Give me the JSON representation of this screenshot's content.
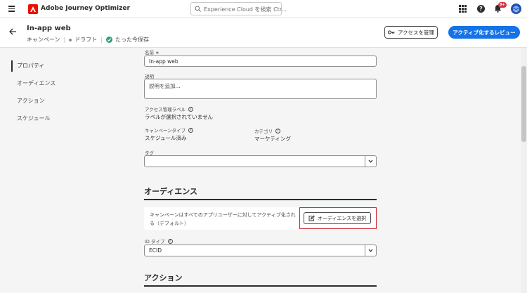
{
  "topbar": {
    "app_name": "Adobe Journey Optimizer",
    "search_placeholder": "Experience Cloud を検索 Ctr...",
    "help_label": "?",
    "notification_count": "9+"
  },
  "header": {
    "title": "In-app web",
    "type": "キャンペーン",
    "status": "ドラフト",
    "save_status": "たった今保存",
    "access_button": "アクセスを管理",
    "review_button": "アクティブ化するレビュー"
  },
  "nav": {
    "items": [
      {
        "label": "プロパティ"
      },
      {
        "label": "オーディエンス"
      },
      {
        "label": "アクション"
      },
      {
        "label": "スケジュール"
      }
    ]
  },
  "form": {
    "name_label": "名前 ∗",
    "name_value": "In-app web",
    "description_label": "説明",
    "description_placeholder": "説明を追加...",
    "access_label": "アクセス管理ラベル",
    "access_value": "ラベルが選択されていません",
    "campaign_type_label": "キャンペーンタイプ",
    "campaign_type_value": "スケジュール済み",
    "category_label": "カテゴリ",
    "category_value": "マーケティング",
    "tag_label": "タグ"
  },
  "audience": {
    "title": "オーディエンス",
    "description": "キャンペーンはすべてのアプリユーザーに対してアクティブ化される（デフォルト）",
    "select_button": "オーディエンスを選択",
    "id_type_label": "ID タイプ",
    "id_type_value": "ECID"
  },
  "action": {
    "title": "アクション"
  },
  "colors": {
    "accent": "#1473e6",
    "brand": "#eb1000",
    "highlight": "#c9252d",
    "success": "#2d9d78"
  }
}
